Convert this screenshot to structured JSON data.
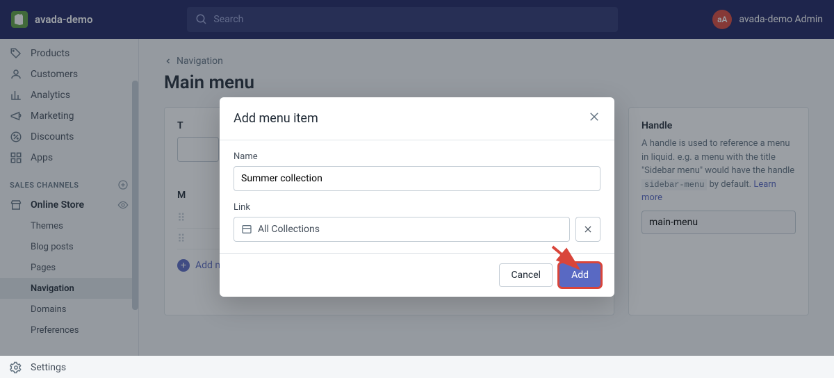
{
  "header": {
    "brand": "avada-demo",
    "search_placeholder": "Search",
    "user_initials": "aA",
    "user_name": "avada-demo Admin"
  },
  "sidebar": {
    "items": [
      {
        "icon": "products",
        "label": "Products"
      },
      {
        "icon": "customers",
        "label": "Customers"
      },
      {
        "icon": "analytics",
        "label": "Analytics"
      },
      {
        "icon": "marketing",
        "label": "Marketing"
      },
      {
        "icon": "discounts",
        "label": "Discounts"
      },
      {
        "icon": "apps",
        "label": "Apps"
      }
    ],
    "section_label": "SALES CHANNELS",
    "online_store": "Online Store",
    "sub_items": [
      "Themes",
      "Blog posts",
      "Pages",
      "Navigation",
      "Domains",
      "Preferences"
    ],
    "settings": "Settings"
  },
  "content": {
    "breadcrumb": "Navigation",
    "title": "Main menu",
    "title_card_label": "T",
    "menu_card_label": "M",
    "handle_label": "Handle",
    "handle_desc_1": "A handle is used to reference a menu in liquid. e.g. a menu with the title \"Sidebar menu\" would have the handle ",
    "handle_code": "sidebar-menu",
    "handle_desc_2": " by default. ",
    "learn_more": "Learn more",
    "handle_value": "main-menu",
    "add_link": "Add menu item"
  },
  "modal": {
    "title": "Add menu item",
    "name_label": "Name",
    "name_value": "Summer collection",
    "link_label": "Link",
    "link_value": "All Collections",
    "cancel": "Cancel",
    "add": "Add"
  }
}
